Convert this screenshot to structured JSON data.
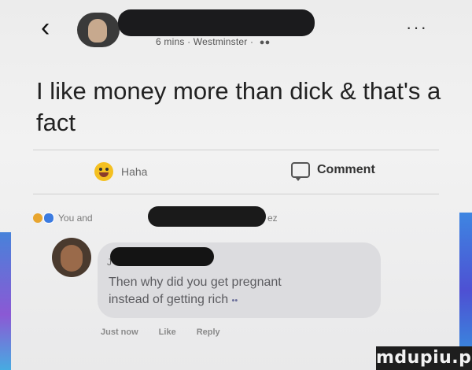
{
  "header": {
    "back_glyph": "‹",
    "meta": "6 mins · Westminster ·",
    "more_glyph": "···",
    "group_icon": "group-icon"
  },
  "post": {
    "text": "I like money more than dick & that's a fact"
  },
  "actions": {
    "reaction_label": "Haha",
    "comment_label": "Comment"
  },
  "reactions_summary": {
    "prefix": "You and",
    "suffix": "ez"
  },
  "comment": {
    "name_initial": "J",
    "text_line1": "Then why did you get pregnant",
    "text_line2": "instead of getting rich",
    "emoji": "••",
    "actions": [
      "Just now",
      "Like",
      "Reply"
    ]
  },
  "watermark": "mdupiu.pl",
  "colors": {
    "background": "#ececec",
    "text": "#222222",
    "bubble": "#dcdcdf",
    "edge_accent": "#2a6fd6"
  }
}
